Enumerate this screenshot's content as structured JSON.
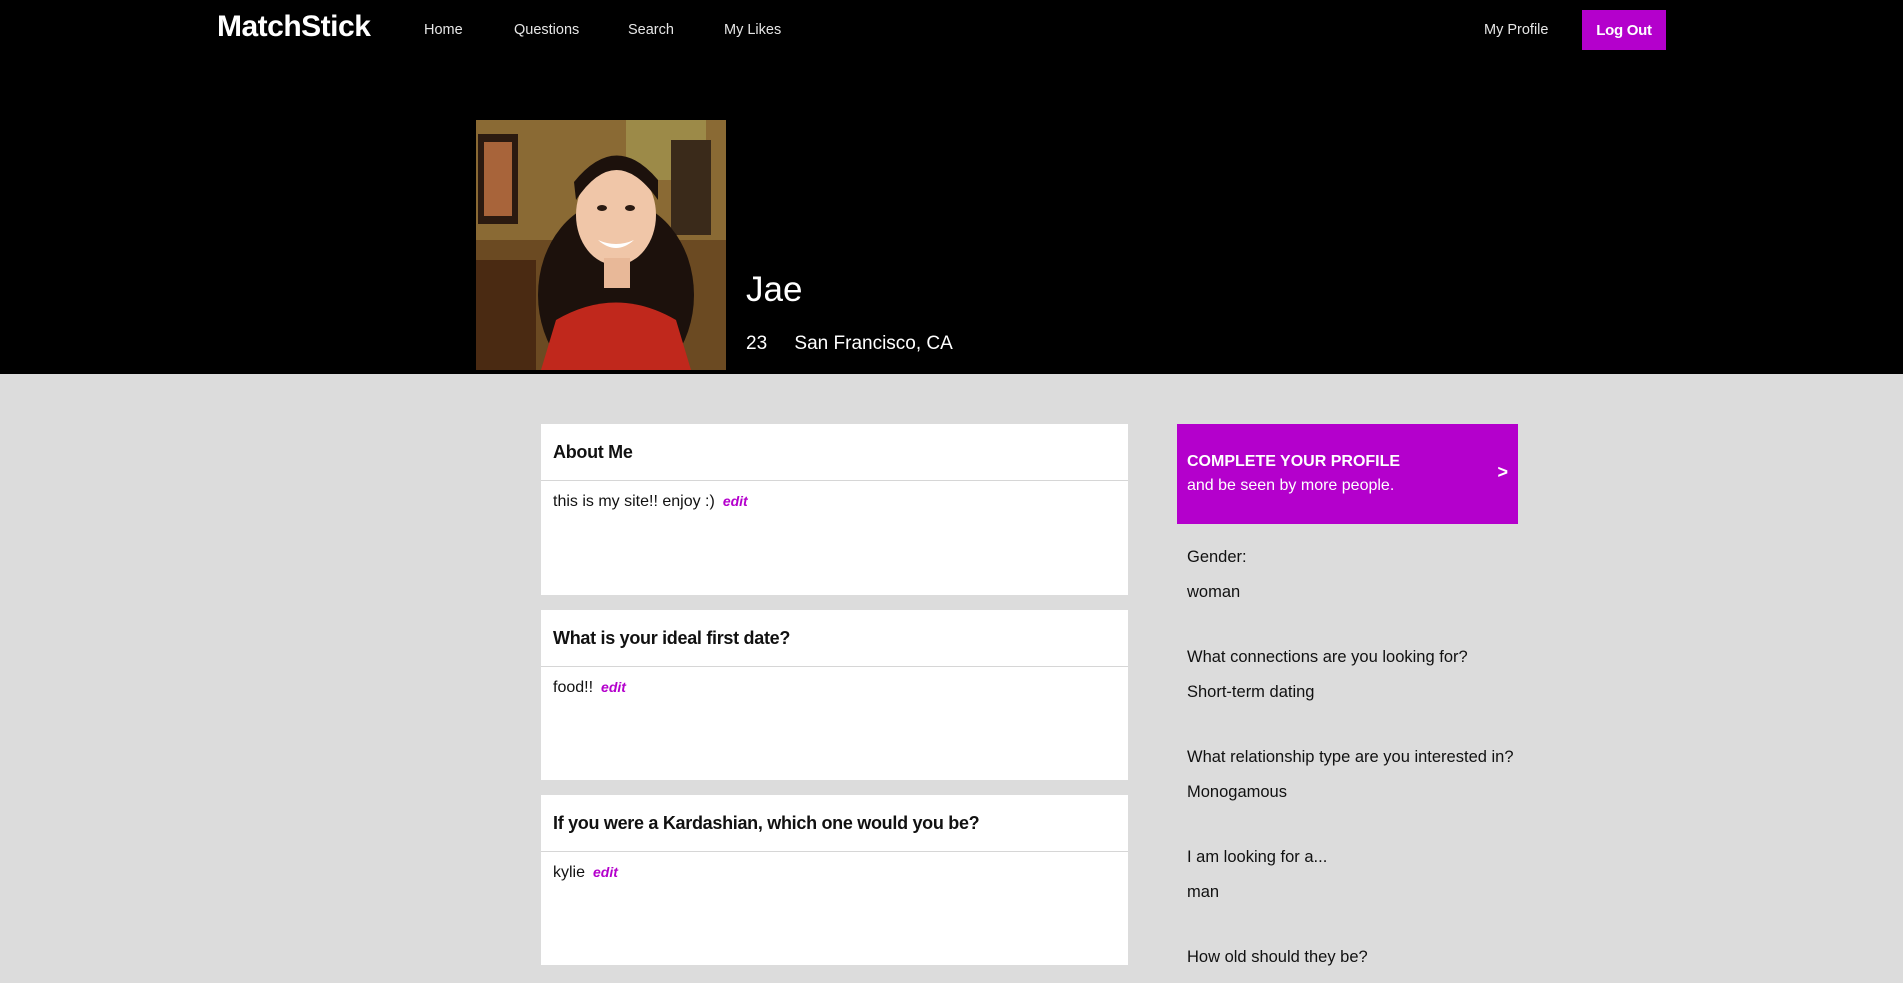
{
  "nav": {
    "logo": "MatchStick",
    "links": [
      "Home",
      "Questions",
      "Search",
      "My Likes"
    ],
    "my_profile": "My Profile",
    "logout": "Log Out"
  },
  "profile": {
    "name": "Jae",
    "age": "23",
    "location": "San Francisco, CA"
  },
  "cards": [
    {
      "title": "About Me",
      "answer": "this is my site!! enjoy :)",
      "edit": "edit"
    },
    {
      "title": "What is your ideal first date?",
      "answer": "food!!",
      "edit": "edit"
    },
    {
      "title": "If you were a Kardashian, which one would you be?",
      "answer": "kylie",
      "edit": "edit"
    }
  ],
  "cta": {
    "title": "COMPLETE YOUR PROFILE",
    "subtitle": "and be seen by more people.",
    "arrow": ">"
  },
  "details": [
    {
      "question": "Gender:",
      "answer": "woman"
    },
    {
      "question": "What connections are you looking for?",
      "answer": "Short-term dating"
    },
    {
      "question": "What relationship type are you interested in?",
      "answer": "Monogamous"
    },
    {
      "question": "I am looking for a...",
      "answer": "man"
    },
    {
      "question": "How old should they be?",
      "answer": ""
    }
  ],
  "colors": {
    "accent": "#b400cc",
    "header_bg": "#000000",
    "page_bg": "#dcdcdc"
  }
}
